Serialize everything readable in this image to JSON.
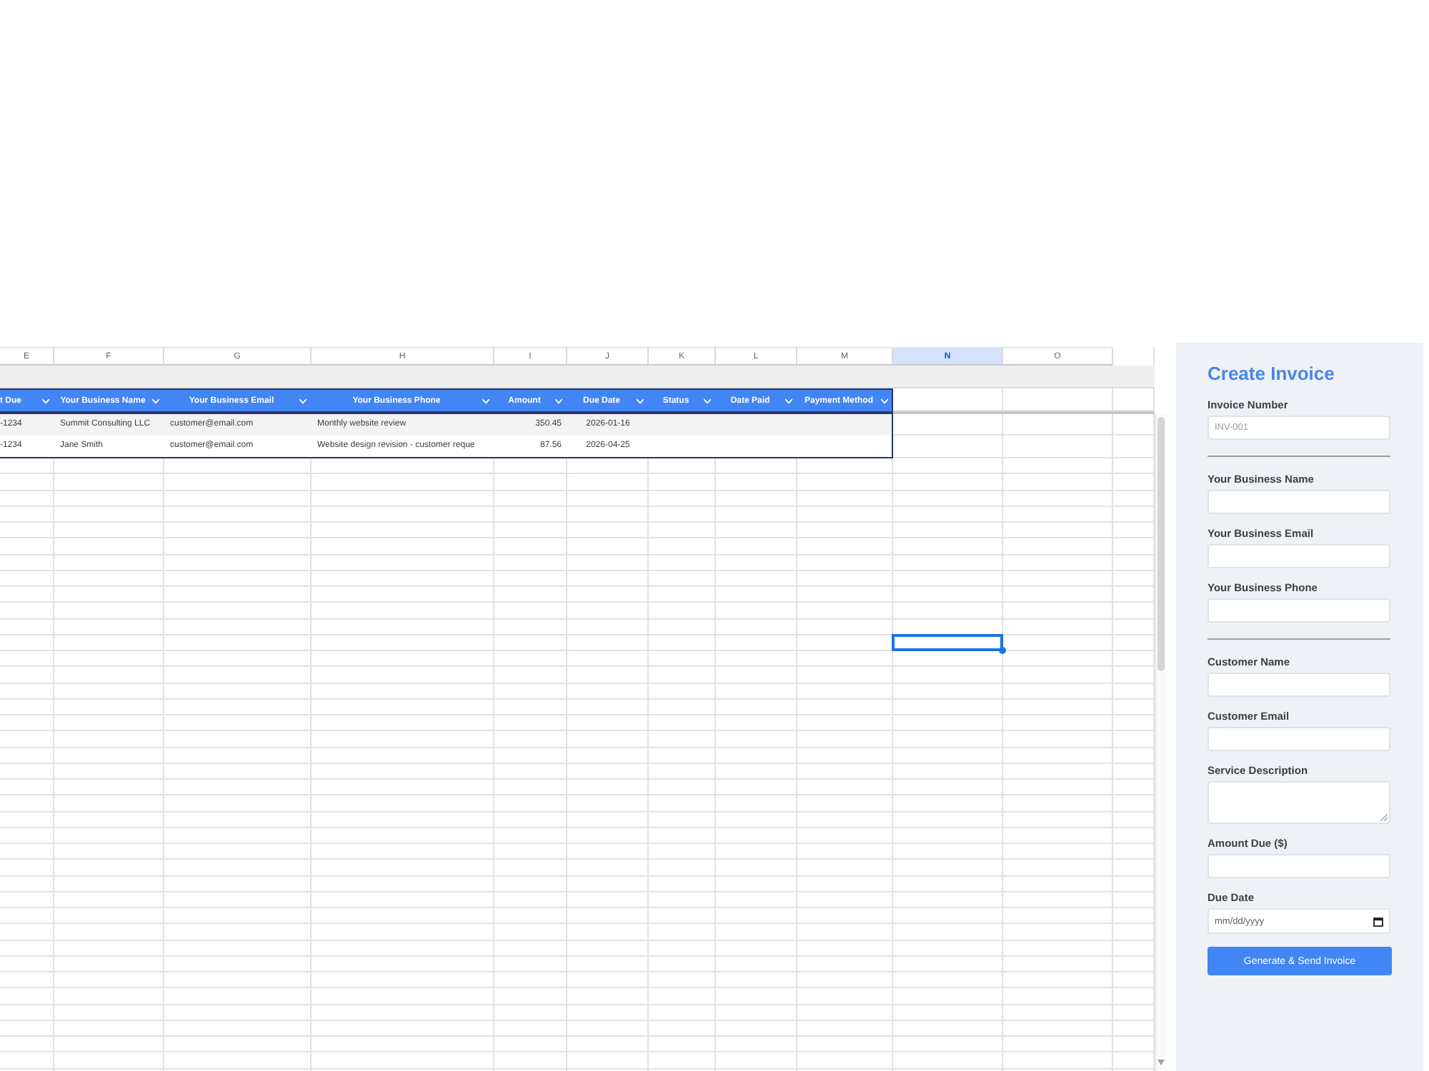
{
  "sheet": {
    "column_letters": [
      {
        "label": "E",
        "selected": false
      },
      {
        "label": "F",
        "selected": false
      },
      {
        "label": "G",
        "selected": false
      },
      {
        "label": "H",
        "selected": false
      },
      {
        "label": "I",
        "selected": false
      },
      {
        "label": "J",
        "selected": false
      },
      {
        "label": "K",
        "selected": false
      },
      {
        "label": "L",
        "selected": false
      },
      {
        "label": "M",
        "selected": false
      },
      {
        "label": "N",
        "selected": true
      },
      {
        "label": "O",
        "selected": false
      }
    ],
    "table": {
      "columns": [
        "t Due",
        "Your Business Name",
        "Your Business Email",
        "Your Business Phone",
        "Amount",
        "Due Date",
        "Status",
        "Date Paid",
        "Payment Method"
      ],
      "rows": [
        {
          "cells": [
            "-1234",
            "Summit Consulting LLC",
            "customer@email.com",
            "Monthly website review",
            "350.45",
            "2026-01-16"
          ]
        },
        {
          "cells": [
            "-1234",
            "Jane Smith",
            "customer@email.com",
            "Website design revision - customer reque",
            "87.56",
            "2026-04-25"
          ]
        }
      ]
    },
    "blank_rows": [
      {
        "selected": false
      },
      {
        "selected": false
      },
      {
        "selected": false
      },
      {
        "selected": false
      },
      {
        "selected": false
      },
      {
        "selected": false
      },
      {
        "selected": false
      },
      {
        "selected": false
      },
      {
        "selected": false
      },
      {
        "selected": false
      },
      {
        "selected": false
      },
      {
        "selected": true
      },
      {
        "selected": false
      },
      {
        "selected": false
      },
      {
        "selected": false
      },
      {
        "selected": false
      },
      {
        "selected": false
      },
      {
        "selected": false
      },
      {
        "selected": false
      },
      {
        "selected": false
      },
      {
        "selected": false
      },
      {
        "selected": false
      },
      {
        "selected": false
      },
      {
        "selected": false
      },
      {
        "selected": false
      },
      {
        "selected": false
      },
      {
        "selected": false
      },
      {
        "selected": false
      },
      {
        "selected": false
      },
      {
        "selected": false
      },
      {
        "selected": false
      },
      {
        "selected": false
      },
      {
        "selected": false
      },
      {
        "selected": false
      },
      {
        "selected": false
      },
      {
        "selected": false
      },
      {
        "selected": false
      },
      {
        "selected": false
      }
    ]
  },
  "invoice_form": {
    "title": "Create Invoice",
    "sections": [
      {
        "fields": [
          {
            "kind": "text",
            "label": "Invoice Number",
            "placeholder": "INV-001"
          }
        ]
      },
      {
        "fields": [
          {
            "kind": "text",
            "label": "Your Business Name"
          },
          {
            "kind": "text",
            "label": "Your Business Email"
          },
          {
            "kind": "text",
            "label": "Your Business Phone"
          }
        ]
      },
      {
        "fields": [
          {
            "kind": "text",
            "label": "Customer Name"
          },
          {
            "kind": "text",
            "label": "Customer Email"
          },
          {
            "kind": "textarea",
            "label": "Service Description"
          },
          {
            "kind": "text",
            "label": "Amount Due ($)"
          },
          {
            "kind": "date",
            "label": "Due Date",
            "placeholder": "mm/dd/yyyy"
          }
        ]
      }
    ],
    "submit_button": "Generate & Send Invoice"
  }
}
